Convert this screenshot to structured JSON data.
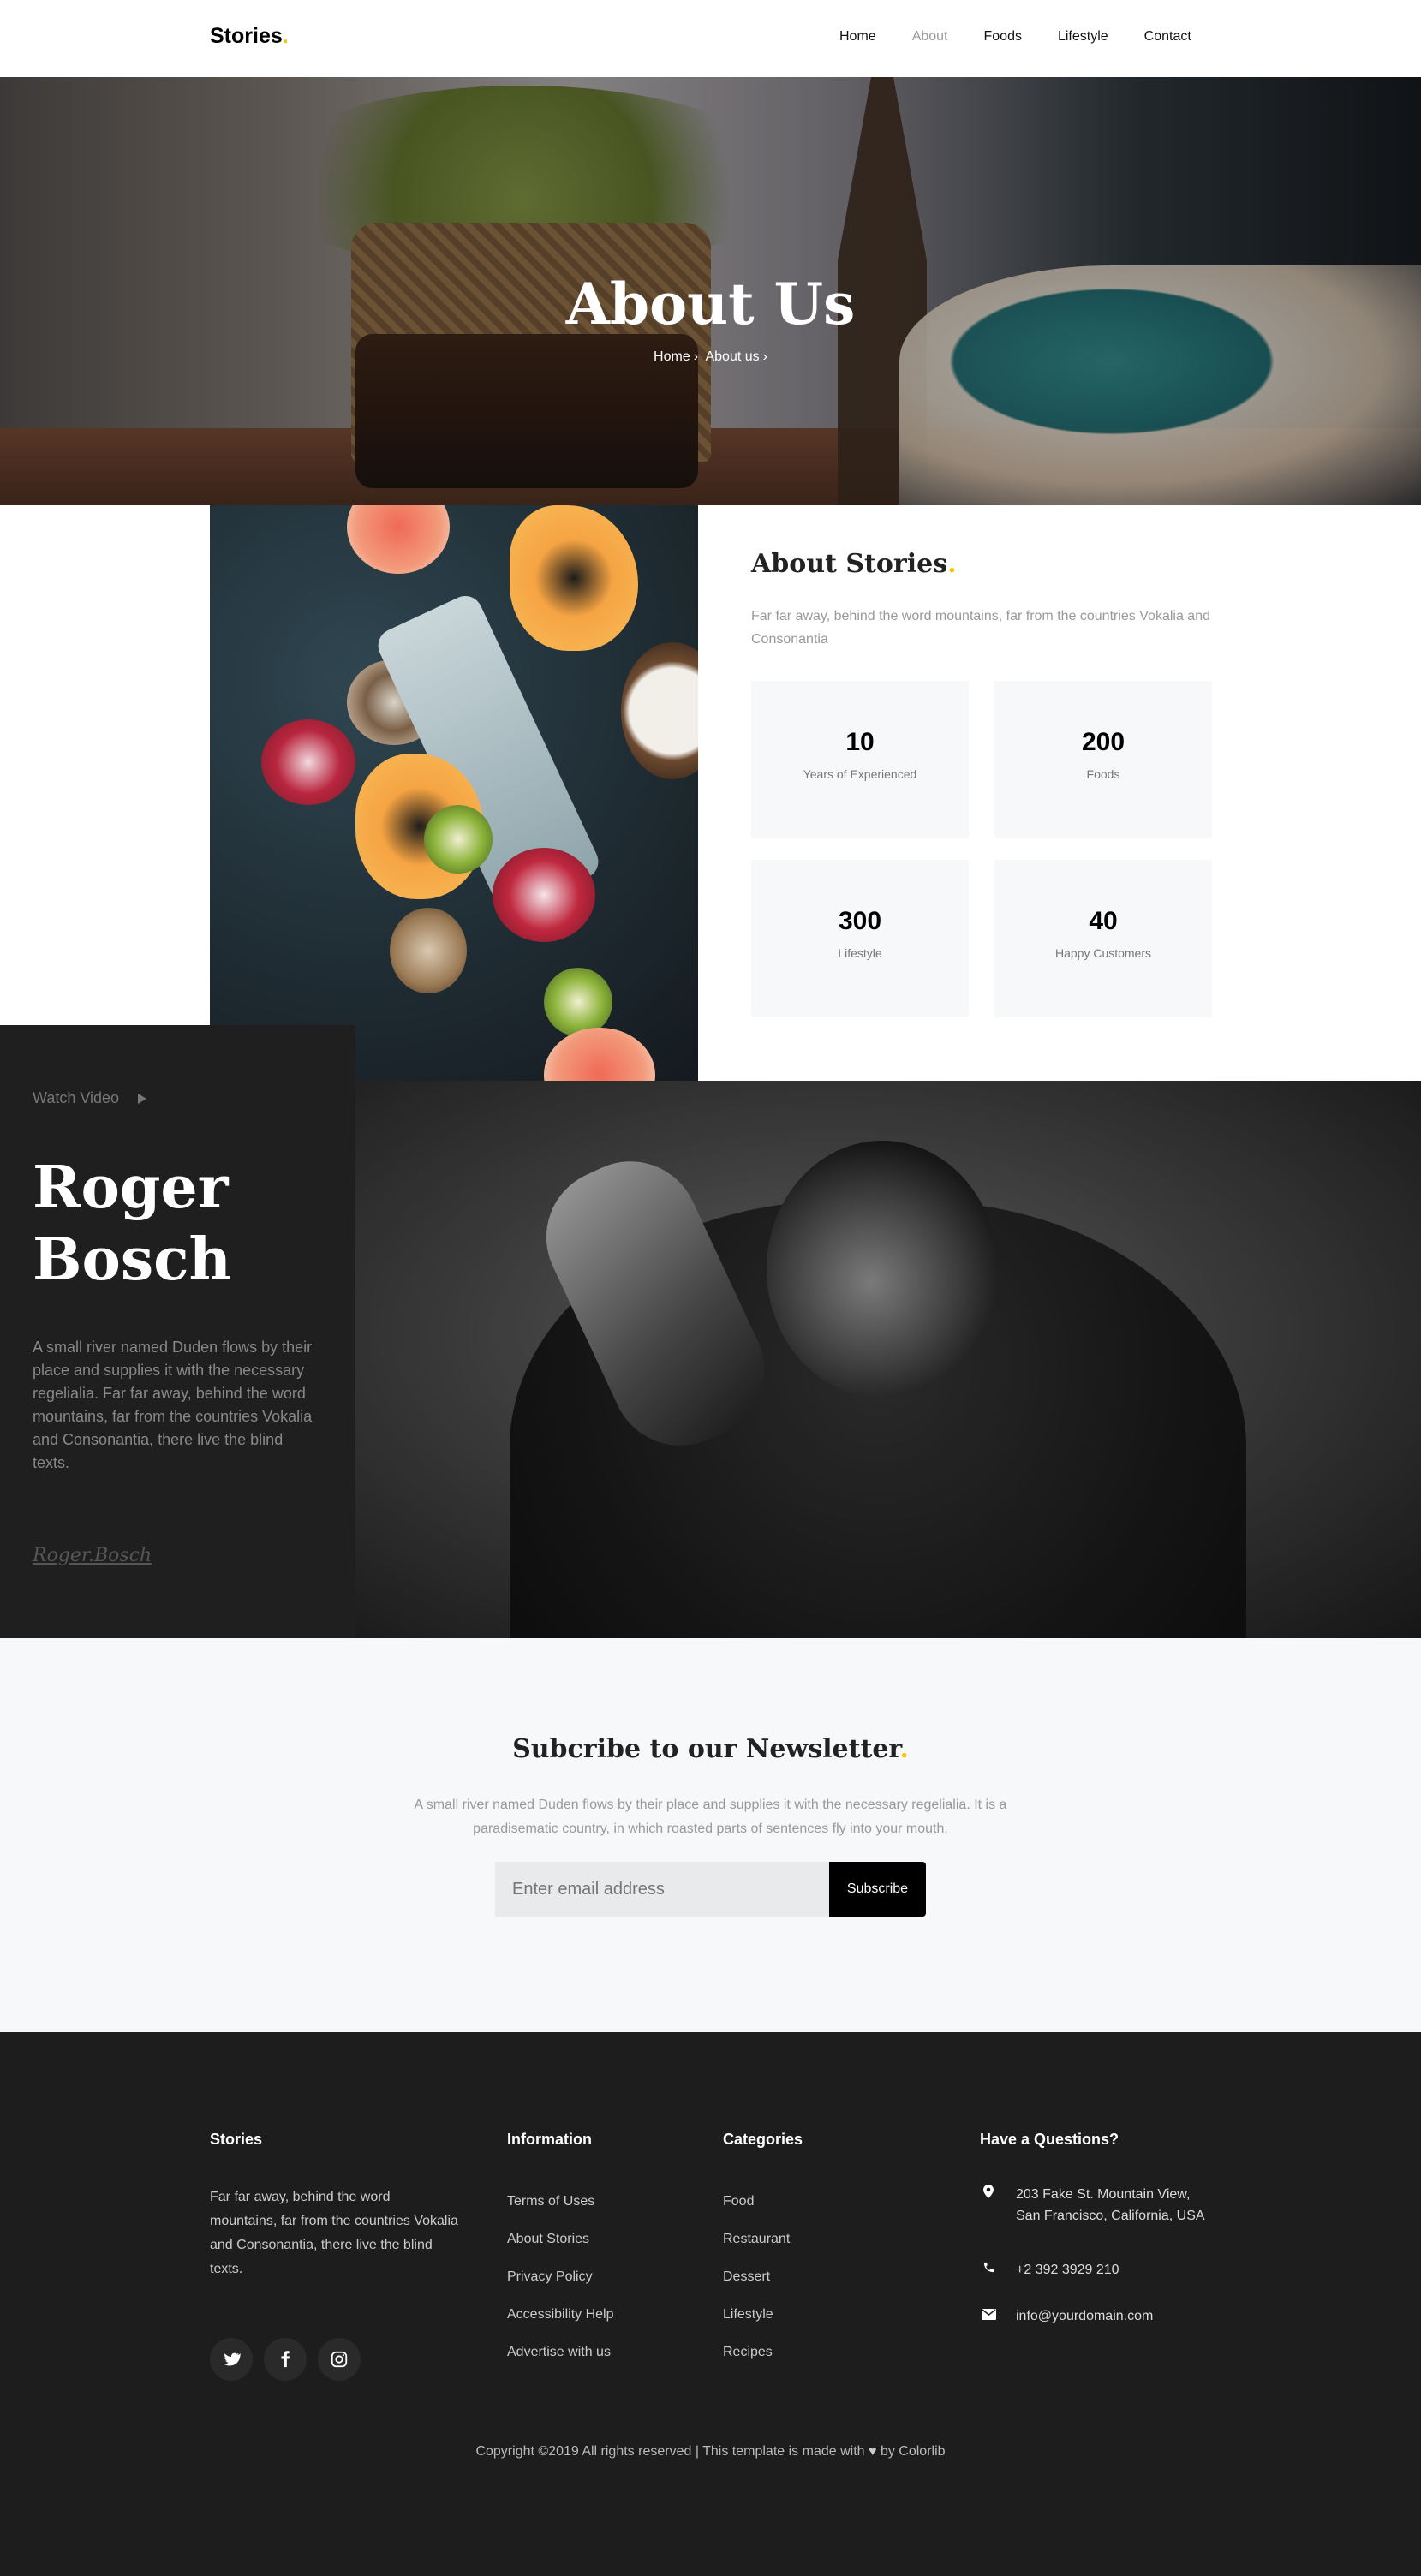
{
  "brand": {
    "name": "Stories",
    "dot": ".",
    "accent": "#f5c800"
  },
  "nav": {
    "items": [
      "Home",
      "About",
      "Foods",
      "Lifestyle",
      "Contact"
    ],
    "active": "About"
  },
  "hero": {
    "title": "About Us",
    "breadcrumb_home": "Home",
    "breadcrumb_current": "About us"
  },
  "about": {
    "title": "About Stories",
    "title_dot": ".",
    "description": "Far far away, behind the word mountains, far from the countries Vokalia and Consonantia",
    "stats": [
      {
        "value": "10",
        "label": "Years of Experienced"
      },
      {
        "value": "200",
        "label": "Foods"
      },
      {
        "value": "300",
        "label": "Lifestyle"
      },
      {
        "value": "40",
        "label": "Happy Customers"
      }
    ]
  },
  "profile": {
    "watch_label": "Watch Video",
    "name_line1": "Roger",
    "name_line2": "Bosch",
    "bio": "A small river named Duden flows by their place and supplies it with the necessary regelialia. Far far away, behind the word mountains, far from the countries Vokalia and Consonantia, there live the blind texts.",
    "signature": "Roger.Bosch"
  },
  "newsletter": {
    "title": "Subcribe to our Newsletter",
    "title_dot": ".",
    "description": "A small river named Duden flows by their place and supplies it with the necessary regelialia. It is a paradisematic country, in which roasted parts of sentences fly into your mouth.",
    "placeholder": "Enter email address",
    "button": "Subscribe"
  },
  "footer": {
    "col1": {
      "heading": "Stories",
      "text": "Far far away, behind the word mountains, far from the countries Vokalia and Consonantia, there live the blind texts."
    },
    "col2": {
      "heading": "Information",
      "links": [
        "Terms of Uses",
        "About Stories",
        "Privacy Policy",
        "Accessibility Help",
        "Advertise with us"
      ]
    },
    "col3": {
      "heading": "Categories",
      "links": [
        "Food",
        "Restaurant",
        "Dessert",
        "Lifestyle",
        "Recipes"
      ]
    },
    "col4": {
      "heading": "Have a Questions?",
      "address": "203 Fake St. Mountain View, San Francisco, California, USA",
      "phone": "+2 392 3929 210",
      "email": "info@yourdomain.com"
    },
    "social_icons": [
      "twitter-icon",
      "facebook-icon",
      "instagram-icon"
    ],
    "copyright_before": "Copyright ©2019 All rights reserved | This template is made with",
    "copyright_after": "by Colorlib"
  }
}
